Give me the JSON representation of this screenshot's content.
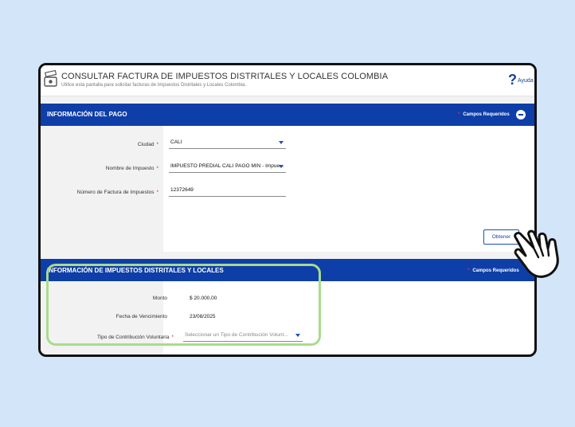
{
  "header": {
    "title": "CONSULTAR FACTURA DE IMPUESTOS DISTRITALES Y LOCALES COLOMBIA",
    "subtitle": "Utilice esta pantalla para solicitar facturas de Impuestos Distritales y Locales Colombia.",
    "help_label": "Ayuda"
  },
  "payment_section": {
    "title": "INFORMACIÓN DEL PAGO",
    "required_label": "Campos Requeridos",
    "fields": {
      "city_label": "Ciudad",
      "city_value": "CALI",
      "tax_name_label": "Nombre de Impuesto",
      "tax_name_value": "IMPUESTO PREDIAL CALI PAGO MIN - Impue...",
      "invoice_label": "Número de Factura de Impuestos",
      "invoice_value": "12372649"
    },
    "obtain_button": "Obtener"
  },
  "tax_section": {
    "title": "INFORMACIÓN DE IMPUESTOS DISTRITALES Y LOCALES",
    "required_label": "Campos Requeridos",
    "amount_label": "Monto",
    "amount_value": "$ 20.000,00",
    "due_label": "Fecha de Vencimiento",
    "due_value": "23/08/2025",
    "contribution_label": "Tipo de Contribución Voluntaria",
    "contribution_placeholder": "Seleccionar un Tipo de Contribución Volunt..."
  },
  "colors": {
    "section_bar": "#0e3ea8",
    "page_background": "#d3e5f8",
    "highlight_outline": "#a9dc8a",
    "required_asterisk": "#d9262e"
  }
}
